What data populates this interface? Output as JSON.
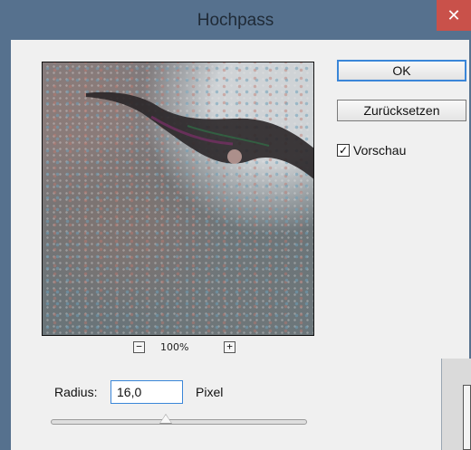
{
  "dialog": {
    "title": "Hochpass",
    "close_glyph": "✕"
  },
  "preview": {
    "zoom_level": "100%",
    "zoom_out_glyph": "−",
    "zoom_in_glyph": "+"
  },
  "buttons": {
    "ok_label": "OK",
    "reset_label": "Zurücksetzen"
  },
  "preview_toggle": {
    "label": "Vorschau",
    "checked": true,
    "check_glyph": "✓"
  },
  "radius": {
    "label": "Radius:",
    "value": "16,0",
    "unit": "Pixel",
    "slider_fraction": 0.45
  },
  "colors": {
    "frame": "#56718e",
    "client": "#f0f0f0",
    "close": "#c9514a",
    "focus": "#3a86d8"
  }
}
